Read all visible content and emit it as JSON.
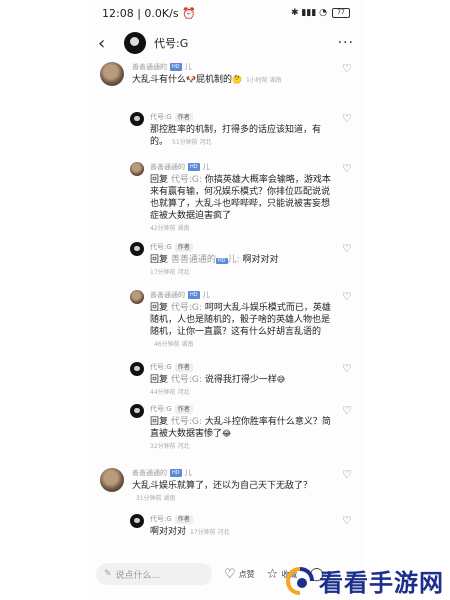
{
  "status_bar": {
    "time": "12:08",
    "speed": "0.0K/s",
    "battery": "77"
  },
  "header": {
    "title": "代号:G",
    "more": "···"
  },
  "comments": [
    {
      "name": "善善通通的",
      "badge": "HD",
      "name_suffix": "儿",
      "text": "大乱斗有什么",
      "emoji": "🐶",
      "text2": "屁机制的",
      "emoji2": "🤔",
      "meta": "1小时前 湖南"
    },
    {
      "name": "代号:G",
      "tag": "作者",
      "text": "那控胜率的机制，打得多的话应该知道，有的。",
      "meta": "51分钟前 河北"
    },
    {
      "name": "善善通通的",
      "badge": "HD",
      "name_suffix": "儿",
      "reply_prefix": "回复",
      "reply_to": "代号:G:",
      "text": "你搞英雄大概率会输略，游戏本来有赢有输，何况娱乐模式？你排位匹配说说也就算了，大乱斗也哔哔哔，只能说被害妄想症被大数据迫害疯了",
      "meta": "42分钟前 湖南"
    },
    {
      "name": "代号:G",
      "tag": "作者",
      "reply_prefix": "回复",
      "reply_to": "善善通通的",
      "badge": "HD",
      "reply_suffix": "儿:",
      "text": "啊对对对",
      "meta": "17分钟前 河北"
    },
    {
      "name": "善善通通的",
      "badge": "HD",
      "name_suffix": "儿",
      "reply_prefix": "回复",
      "reply_to": "代号:G:",
      "text": "呵呵大乱斗娱乐模式而已，英雄随机，人也是随机的，骰子啥的英雄人物也是随机，让你一直赢？这有什么好胡言乱语的",
      "meta": "46分钟前 湖南"
    },
    {
      "name": "代号:G",
      "tag": "作者",
      "reply_prefix": "回复",
      "reply_to": "代号:G:",
      "text": "说得我打得少一样",
      "emoji": "😅",
      "meta": "44分钟前 河北"
    },
    {
      "name": "代号:G",
      "tag": "作者",
      "reply_prefix": "回复",
      "reply_to": "代号:G:",
      "text": "大乱斗控你胜率有什么意义？简直被大数据害惨了",
      "emoji": "😂",
      "meta": "32分钟前 河北"
    },
    {
      "name": "善善通通的",
      "badge": "HD",
      "name_suffix": "儿",
      "text": "大乱斗娱乐就算了，还以为自己天下无敌了？",
      "meta": "31分钟前 湖南"
    },
    {
      "name": "代号:G",
      "tag": "作者",
      "text": "啊对对对",
      "meta": "17分钟前 河北"
    }
  ],
  "bottom_bar": {
    "placeholder": "说点什么...",
    "like_label": "点赞",
    "collect_label": "收藏",
    "comment_count": "1"
  },
  "watermark": {
    "text": "看看手游网"
  },
  "icons": {
    "back": "chevron-left-icon",
    "heart": "heart-icon",
    "edit": "pencil-icon",
    "star": "star-icon",
    "comment": "comment-icon"
  }
}
